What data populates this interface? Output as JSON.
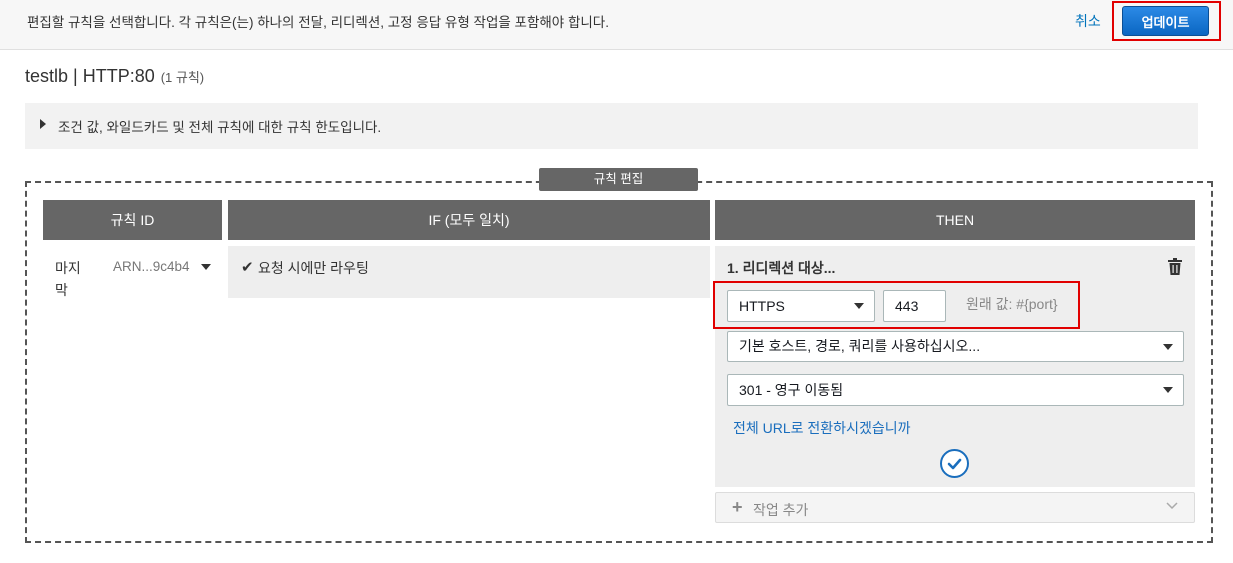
{
  "topbar": {
    "message": "편집할 규칙을 선택합니다. 각 규칙은(는) 하나의 전달, 리디렉션, 고정 응답 유형 작업을 포함해야 합니다.",
    "cancel_label": "취소",
    "update_label": "업데이트"
  },
  "title": {
    "name": "testlb | HTTP:80",
    "count": "(1 규칙)"
  },
  "info": {
    "label": "조건 값, 와일드카드 및 전체 규칙에 대한 규칙 한도입니다."
  },
  "editor": {
    "frame_label": "규칙 편집",
    "columns": [
      "규칙 ID",
      "IF (모두 일치)",
      "THEN"
    ],
    "rule": {
      "id_label": "마지\n막",
      "arn": "ARN...9c4b4"
    },
    "condition": "요청 시에만 라우팅",
    "action": {
      "title": "1. 리디렉션 대상...",
      "protocol": "HTTPS",
      "port": "443",
      "original_value": "원래 값: #{port}",
      "host_path_query": "기본 호스트, 경로, 쿼리를 사용하십시오...",
      "status_code": "301 - 영구 이동됨",
      "full_url_link": "전체 URL로 전환하시겠습니까"
    },
    "add_action_label": "작업 추가"
  },
  "colors": {
    "accent": "#0a6ed1",
    "highlight": "#e10000",
    "header_bg": "#666666",
    "link": "#1a6ebd"
  },
  "icons": [
    "caret-right-icon",
    "caret-down-icon",
    "checkmark-icon",
    "trash-icon",
    "check-circle-icon",
    "plus-icon",
    "chevron-down-icon"
  ]
}
